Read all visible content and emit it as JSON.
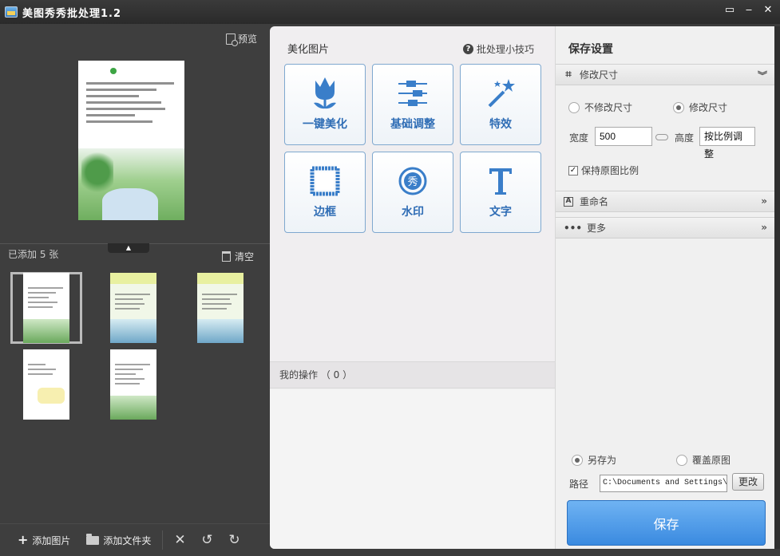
{
  "window": {
    "title": "美图秀秀批处理1.2"
  },
  "left": {
    "preview_label": "预览",
    "added_count_label": "已添加 5 张",
    "clear_label": "清空",
    "thumbnail_count": 5,
    "bottom": {
      "add_image": "添加图片",
      "add_folder": "添加文件夹"
    }
  },
  "middle": {
    "title": "美化图片",
    "tips_label": "批处理小技巧",
    "tools": [
      {
        "label": "一键美化",
        "icon": "tulip-icon"
      },
      {
        "label": "基础调整",
        "icon": "sliders-icon"
      },
      {
        "label": "特效",
        "icon": "magic-wand-icon"
      },
      {
        "label": "边框",
        "icon": "frame-icon"
      },
      {
        "label": "水印",
        "icon": "watermark-stamp-icon"
      },
      {
        "label": "文字",
        "icon": "text-icon"
      }
    ],
    "ops_label": "我的操作 （ 0 ）"
  },
  "right": {
    "title": "保存设置",
    "resize": {
      "header": "修改尺寸",
      "option_no_resize": "不修改尺寸",
      "option_resize": "修改尺寸",
      "selected": "修改尺寸",
      "width_label": "宽度",
      "width_value": "500",
      "height_label": "高度",
      "height_value": "按比例调整",
      "keep_ratio_label": "保持原图比例",
      "keep_ratio_checked": true
    },
    "rename_header": "重命名",
    "more_header": "更多",
    "save_as_label": "另存为",
    "overwrite_label": "覆盖原图",
    "save_mode_selected": "另存为",
    "path_label": "路径",
    "path_value": "C:\\Documents and Settings\\",
    "change_label": "更改",
    "save_label": "保存"
  },
  "colors": {
    "accent_blue": "#3a8ae0",
    "tool_text_blue": "#2f6db5",
    "dark_panel": "#3e3e3e"
  }
}
